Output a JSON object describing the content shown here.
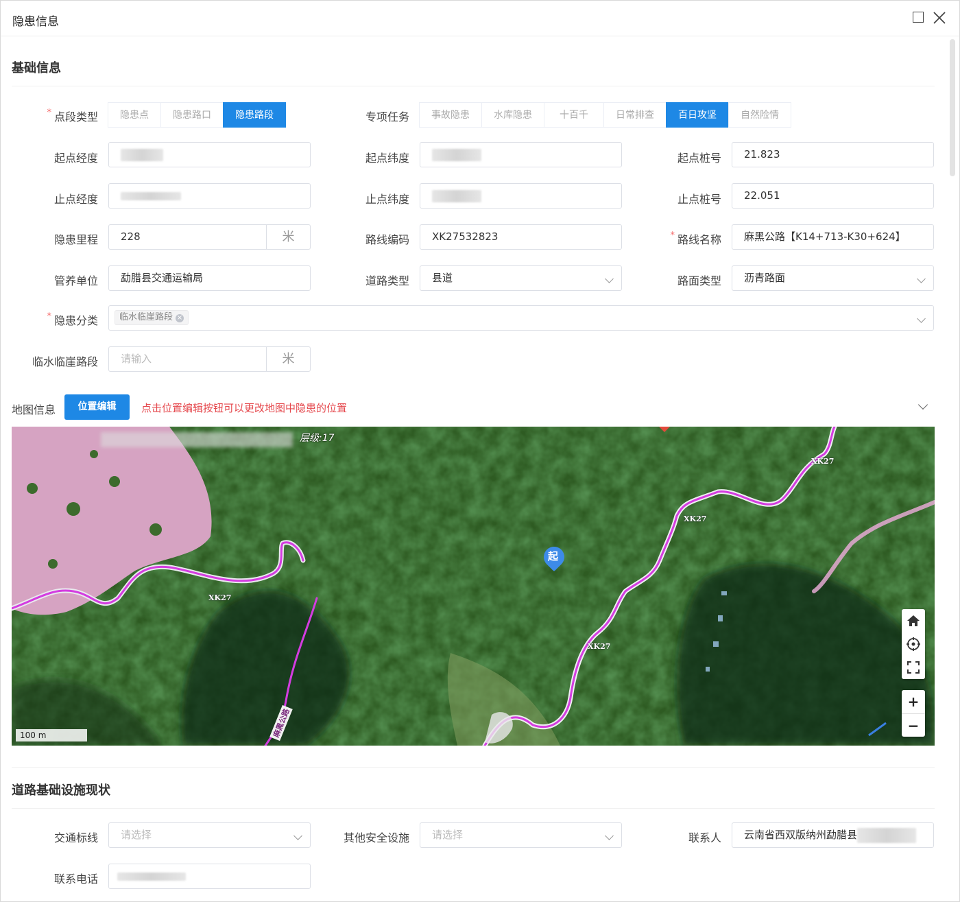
{
  "dialog": {
    "title": "隐患信息",
    "maximize_icon": "square-icon",
    "close_icon": "close-icon"
  },
  "basic_info": {
    "section_title": "基础信息",
    "point_type": {
      "label": "点段类型",
      "options": [
        "隐患点",
        "隐患路口",
        "隐患路段"
      ],
      "selected": "隐患路段"
    },
    "special_task": {
      "label": "专项任务",
      "options": [
        "事故隐患",
        "水库隐患",
        "十百千",
        "日常排查",
        "百日攻坚",
        "自然险情"
      ],
      "selected": "百日攻坚"
    },
    "start_lng": {
      "label": "起点经度"
    },
    "start_lat": {
      "label": "起点纬度"
    },
    "start_stake": {
      "label": "起点桩号",
      "value": "21.823"
    },
    "end_lng": {
      "label": "止点经度"
    },
    "end_lat": {
      "label": "止点纬度"
    },
    "end_stake": {
      "label": "止点桩号",
      "value": "22.051"
    },
    "mileage": {
      "label": "隐患里程",
      "value": "228",
      "unit": "米"
    },
    "route_code": {
      "label": "路线编码",
      "value": "XK27532823"
    },
    "route_name": {
      "label": "路线名称",
      "value": "麻黑公路【K14+713-K30+624】"
    },
    "maintenance_unit": {
      "label": "管养单位",
      "value": "勐腊县交通运输局"
    },
    "road_type": {
      "label": "道路类型",
      "value": "县道"
    },
    "surface_type": {
      "label": "路面类型",
      "value": "沥青路面"
    },
    "hazard_category": {
      "label": "隐患分类",
      "tag": "临水临崖路段"
    },
    "waterside_section": {
      "label": "临水临崖路段",
      "placeholder": "请输入",
      "unit": "米"
    }
  },
  "map_info": {
    "label": "地图信息",
    "edit_button": "位置编辑",
    "hint": "点击位置编辑按钮可以更改地图中隐患的位置",
    "zoom_level": "层级:17",
    "scale": "100 m",
    "road_labels": [
      "XK27",
      "XK27",
      "XK27",
      "XK27",
      "麻黑公路"
    ],
    "marker_label": "起",
    "controls": [
      "home-icon",
      "locate-icon",
      "fullscreen-icon",
      "zoom-in-icon",
      "zoom-out-icon"
    ],
    "controls_text": {
      "zoom_in": "+",
      "zoom_out": "−"
    },
    "colors": {
      "road": "#d43ce0",
      "vegetation": "#2f5a22",
      "clearing": "#d9a2c4"
    }
  },
  "infrastructure": {
    "section_title": "道路基础设施现状",
    "traffic_marking": {
      "label": "交通标线",
      "placeholder": "请选择"
    },
    "other_safety": {
      "label": "其他安全设施",
      "placeholder": "请选择"
    },
    "contact": {
      "label": "联系人",
      "value": "云南省西双版纳州勐腊县"
    },
    "phone": {
      "label": "联系电话"
    }
  },
  "colors": {
    "primary": "#1e88e5",
    "danger": "#e5484d",
    "required": "#f56c6c"
  }
}
